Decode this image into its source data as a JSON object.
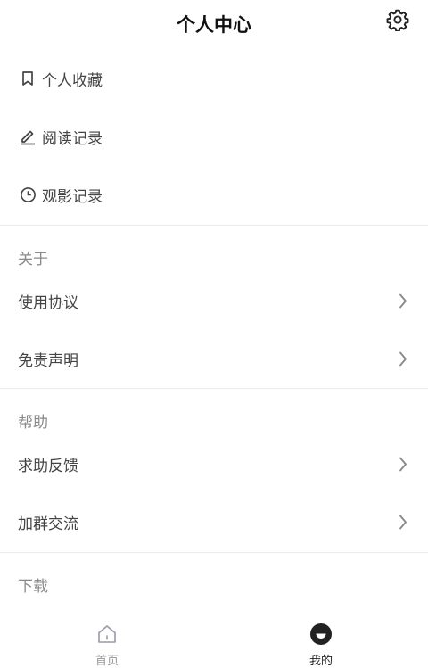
{
  "header": {
    "title": "个人中心",
    "settings_icon": "gear-icon"
  },
  "main_menu": [
    {
      "label": "个人收藏",
      "icon": "bookmark-icon"
    },
    {
      "label": "阅读记录",
      "icon": "pencil-icon"
    },
    {
      "label": "观影记录",
      "icon": "clock-icon"
    }
  ],
  "about": {
    "title": "关于",
    "items": [
      {
        "label": "使用协议"
      },
      {
        "label": "免责声明"
      }
    ]
  },
  "help": {
    "title": "帮助",
    "items": [
      {
        "label": "求助反馈"
      },
      {
        "label": "加群交流"
      }
    ]
  },
  "download": {
    "title": "下载"
  },
  "tabbar": {
    "tabs": [
      {
        "label": "首页",
        "icon": "home-icon",
        "active": false
      },
      {
        "label": "我的",
        "icon": "profile-icon",
        "active": true
      }
    ]
  },
  "colors": {
    "text": "#444444",
    "muted": "#8a8a8a",
    "divider": "#ececec",
    "active_tab": "#222222",
    "inactive_tab": "#999999"
  }
}
